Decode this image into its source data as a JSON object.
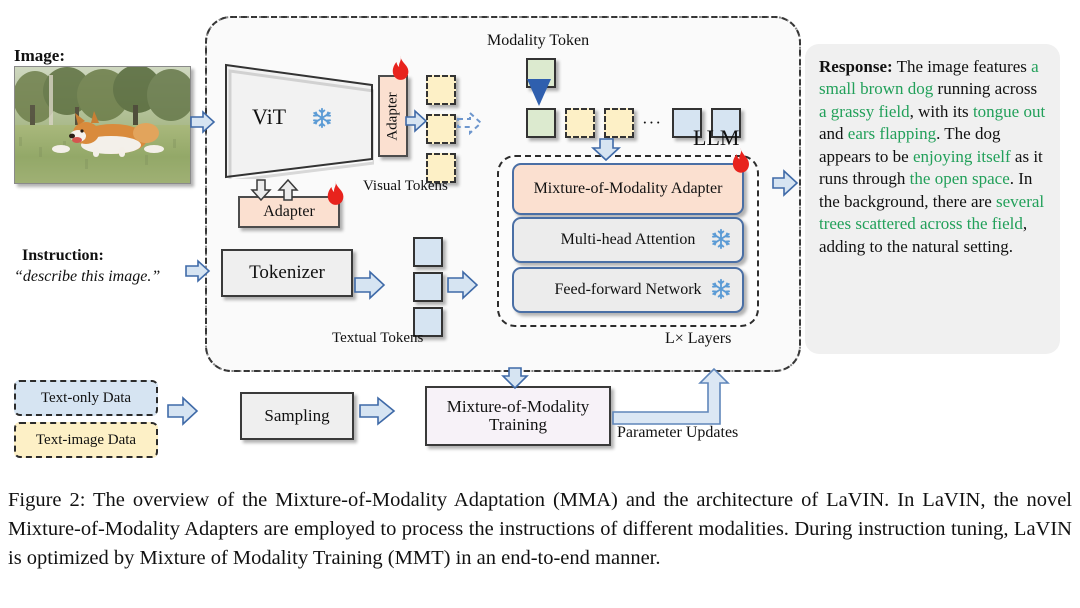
{
  "figure": {
    "caption": "Figure 2:  The overview of the Mixture-of-Modality Adaptation (MMA) and the architecture of LaVIN. In LaVIN, the novel Mixture-of-Modality Adapters are employed to process the instructions of different modalities.  During instruction tuning, LaVIN is optimized by Mixture of Modality Training (MMT) in an end-to-end manner."
  },
  "inputs": {
    "image_label": "Image:",
    "image_alt": "corgi-dog-running-in-grassy-field",
    "instruction_label": "Instruction:",
    "instruction_text": "“describe this image.”"
  },
  "encoder": {
    "vit_label": "ViT",
    "vit_frozen_icon": "snowflake-icon",
    "adapter_vertical_label": "Adapter",
    "adapter_horizontal_label": "Adapter",
    "adapter_trainable_icon": "flame-icon",
    "tokenizer_label": "Tokenizer",
    "visual_tokens_label": "Visual Tokens",
    "textual_tokens_label": "Textual Tokens"
  },
  "modality": {
    "token_label": "Modality Token",
    "ellipsis": "···"
  },
  "llm": {
    "label": "LLM",
    "layers_label": "L× Layers",
    "rows": [
      {
        "label": "Mixture-of-Modality Adapter",
        "state_icon": "flame-icon"
      },
      {
        "label": "Multi-head Attention",
        "state_icon": "snowflake-icon"
      },
      {
        "label": "Feed-forward Network",
        "state_icon": "snowflake-icon"
      }
    ]
  },
  "response": {
    "prefix": "Response:",
    "segments": [
      {
        "text": " The image features ",
        "highlight": false
      },
      {
        "text": "a small brown dog",
        "highlight": true
      },
      {
        "text": " running across ",
        "highlight": false
      },
      {
        "text": "a grassy field",
        "highlight": true
      },
      {
        "text": ", with its ",
        "highlight": false
      },
      {
        "text": "tongue out",
        "highlight": true
      },
      {
        "text": " and ",
        "highlight": false
      },
      {
        "text": "ears flapping",
        "highlight": true
      },
      {
        "text": ". The dog appears to be ",
        "highlight": false
      },
      {
        "text": "enjoying itself",
        "highlight": true
      },
      {
        "text": " as it runs through ",
        "highlight": false
      },
      {
        "text": "the open space",
        "highlight": true
      },
      {
        "text": ". In the background, there are ",
        "highlight": false
      },
      {
        "text": "several trees scattered across the field",
        "highlight": true
      },
      {
        "text": ", adding to the natural setting.",
        "highlight": false
      }
    ]
  },
  "training": {
    "text_only_data": "Text-only Data",
    "text_image_data": "Text-image Data",
    "sampling": "Sampling",
    "mmt_box": "Mixture-of-Modality Training",
    "parameter_updates": "Parameter Updates"
  },
  "colors": {
    "adapter_fill": "#fbe0d0",
    "visual_token_fill": "#fdf0c6",
    "textual_token_fill": "#d6e4f2",
    "modality_token_fill": "#dceacf",
    "llm_row_border": "#4a6fa5",
    "arrow_fill": "#d6e4f2",
    "arrow_stroke": "#3f6aa8",
    "highlight_green": "#22a05a",
    "flame_red": "#e8231d",
    "snowflake_blue": "#5b9bd5",
    "response_bg": "#f0f0f0"
  }
}
